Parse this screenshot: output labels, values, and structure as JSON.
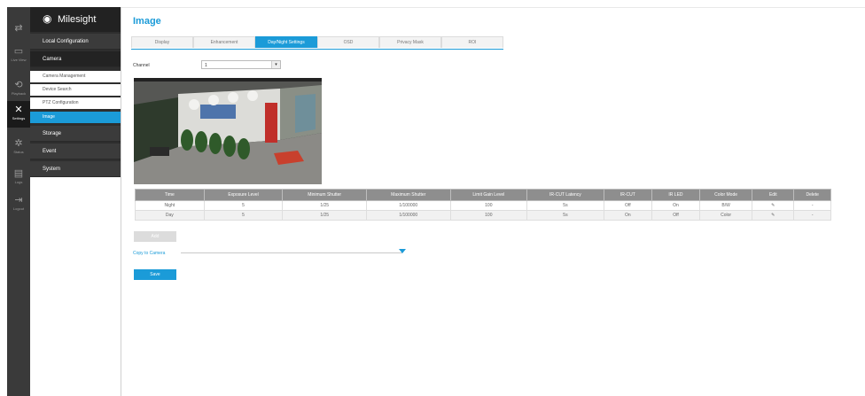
{
  "rail": {
    "items": [
      {
        "icon": "⇄",
        "label": ""
      },
      {
        "icon": "▭",
        "label": "Live View"
      },
      {
        "icon": "⟲",
        "label": "Playback"
      },
      {
        "icon": "✕",
        "label": "Settings"
      },
      {
        "icon": "✲",
        "label": "Status"
      },
      {
        "icon": "▤",
        "label": "Logs"
      },
      {
        "icon": "⇥",
        "label": "Logout"
      }
    ]
  },
  "logo": {
    "text": "Milesight"
  },
  "menu": {
    "local_configuration": "Local Configuration",
    "camera": "Camera",
    "camera_management": "Camera Management",
    "device_search": "Device Search",
    "ptz_configuration": "PTZ Configuration",
    "image": "Image",
    "storage": "Storage",
    "event": "Event",
    "system": "System"
  },
  "page": {
    "title": "Image"
  },
  "tabs": [
    "Display",
    "Enhancement",
    "Day/Night Settings",
    "OSD",
    "Privacy Mask",
    "ROI"
  ],
  "channel": {
    "label": "Channel",
    "value": "1"
  },
  "table": {
    "headers": [
      "Time",
      "Exposure Level",
      "Minimum Shutter",
      "Maximum Shutter",
      "Limit Gain Level",
      "IR-CUT Latency",
      "IR-CUT",
      "IR LED",
      "Color Mode",
      "Edit",
      "Delete"
    ],
    "rows": [
      [
        "Night",
        "5",
        "1/25",
        "1/100000",
        "100",
        "5s",
        "Off",
        "On",
        "B/W",
        "✎",
        "-"
      ],
      [
        "Day",
        "5",
        "1/25",
        "1/100000",
        "100",
        "5s",
        "On",
        "Off",
        "Color",
        "✎",
        "-"
      ]
    ]
  },
  "buttons": {
    "add": "Add",
    "save": "Save"
  },
  "copy": {
    "label": "Copy to Camera"
  },
  "colors": {
    "accent": "#1b9bd8",
    "sidebar": "#2e2e2e"
  }
}
